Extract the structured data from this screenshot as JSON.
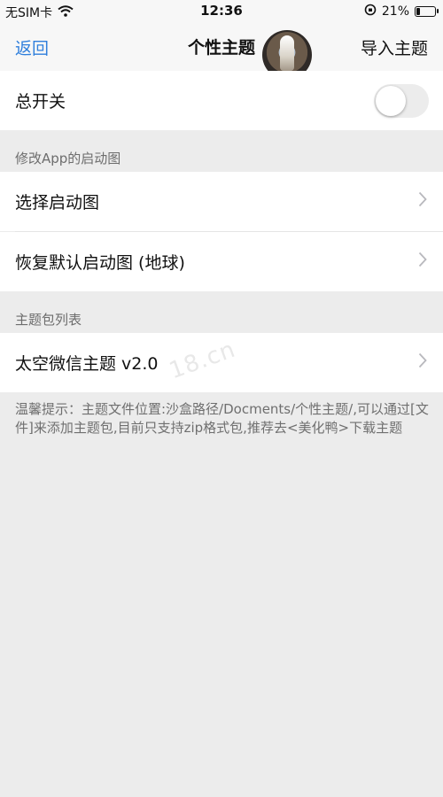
{
  "status": {
    "carrier": "无SIM卡",
    "time": "12:36",
    "battery_percent": "21%",
    "battery_level": 0.21
  },
  "nav": {
    "back_label": "返回",
    "title": "个性主题",
    "import_label": "导入主题"
  },
  "master_switch": {
    "label": "总开关",
    "enabled": false
  },
  "launch_section": {
    "header": "修改App的启动图",
    "items": [
      {
        "label": "选择启动图"
      },
      {
        "label": "恢复默认启动图 (地球)"
      }
    ]
  },
  "theme_section": {
    "header": "主题包列表",
    "items": [
      {
        "label": "太空微信主题 v2.0"
      }
    ]
  },
  "hint": "温馨提示：主题文件位置:沙盒路径/Docments/个性主题/,可以通过[文件]来添加主题包,目前只支持zip格式包,推荐去<美化鸭>下载主题",
  "watermark": "18.cn",
  "colors": {
    "accent": "#2f7fdc",
    "background": "#ececec"
  }
}
